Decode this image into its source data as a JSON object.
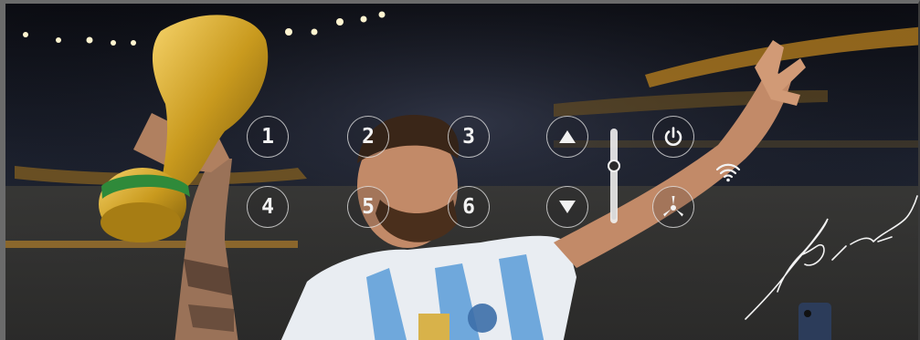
{
  "controls": {
    "buttons": [
      {
        "label": "1"
      },
      {
        "label": "2"
      },
      {
        "label": "3"
      },
      {
        "label": "4"
      },
      {
        "label": "5"
      },
      {
        "label": "6"
      }
    ],
    "arrow_up_icon": "triangle-up-icon",
    "arrow_down_icon": "triangle-down-icon",
    "power_icon": "power-icon",
    "fan_icon": "fan-icon",
    "wifi_icon": "wifi-icon",
    "level": 0.62
  },
  "colors": {
    "button_border": "#ebebeb",
    "accent_white": "#f2f2f2",
    "jersey_blue": "#6fa8dc",
    "trophy_gold": "#d4a017"
  }
}
